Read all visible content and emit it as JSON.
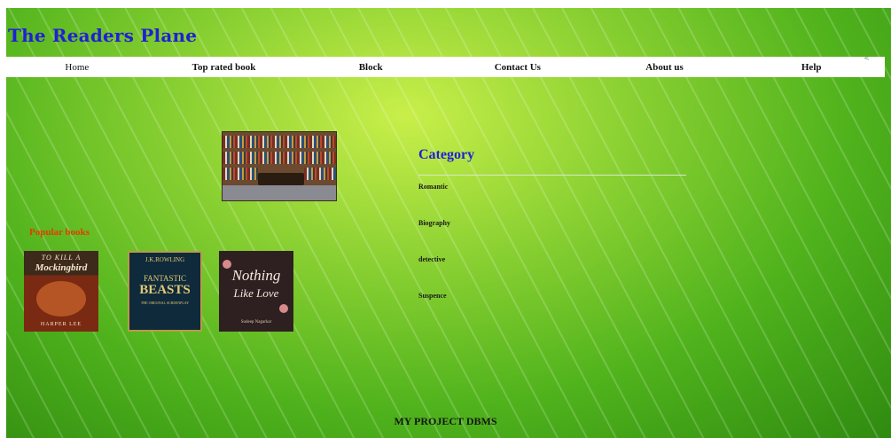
{
  "site": {
    "title": "The Readers Plane"
  },
  "nav": {
    "items": [
      {
        "label": "Home"
      },
      {
        "label": "Top rated book"
      },
      {
        "label": "Block"
      },
      {
        "label": "Contact Us"
      },
      {
        "label": "About us"
      },
      {
        "label": "Help"
      }
    ],
    "arrow": "<"
  },
  "popular": {
    "heading": "Popular books",
    "books": [
      {
        "title_line1": "TO KILL A",
        "title_line2": "Mockingbird",
        "author": "HARPER LEE"
      },
      {
        "author": "J.K.ROWLING",
        "title_line1": "FANTASTIC",
        "title_line2": "BEASTS",
        "subtitle": "THE ORIGINAL SCREENPLAY"
      },
      {
        "title_line1": "Nothing",
        "title_line2": "Like Love",
        "author": "Sudeep Nagarkar"
      }
    ]
  },
  "category": {
    "heading": "Category",
    "items": [
      "Romantic",
      "Biography",
      "detective",
      "Suspence"
    ]
  },
  "footer": {
    "text": "MY PROJECT DBMS"
  },
  "colors": {
    "title": "#1f1fd6",
    "popular_heading": "#e33c00",
    "nav_bg": "#ffffff"
  }
}
